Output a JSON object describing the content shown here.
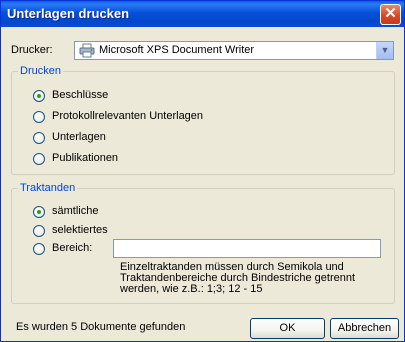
{
  "window": {
    "title": "Unterlagen drucken"
  },
  "printer": {
    "label": "Drucker:",
    "value": "Microsoft XPS Document Writer"
  },
  "print_group": {
    "legend": "Drucken",
    "options": [
      {
        "label": "Beschlüsse",
        "checked": true
      },
      {
        "label": "Protokollrelevanten Unterlagen",
        "checked": false
      },
      {
        "label": "Unterlagen",
        "checked": false
      },
      {
        "label": "Publikationen",
        "checked": false
      }
    ]
  },
  "traktanden_group": {
    "legend": "Traktanden",
    "options": [
      {
        "label": "sämtliche",
        "checked": true
      },
      {
        "label": "selektiertes",
        "checked": false
      },
      {
        "label": "Bereich:",
        "checked": false
      }
    ],
    "range_value": "",
    "hint_lines": [
      "Einzeltraktanden müssen durch Semikola und",
      "Traktandenbereiche durch Bindestriche getrennt",
      "werden, wie z.B.: 1;3;  12 - 15"
    ]
  },
  "footer": {
    "status": "Es wurden 5 Dokumente gefunden",
    "ok_label": "OK",
    "cancel_label": "Abbrechen"
  }
}
